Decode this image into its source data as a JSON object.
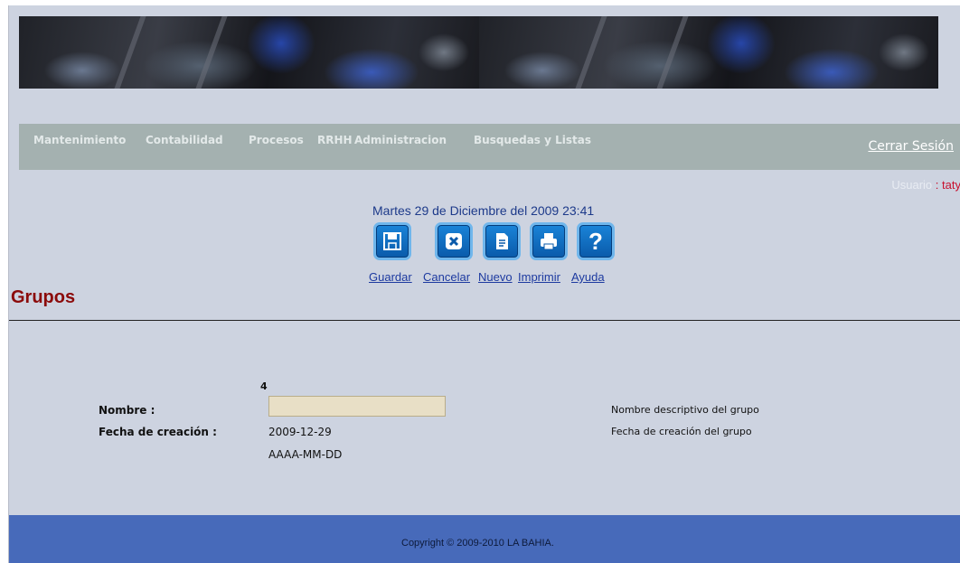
{
  "nav": {
    "items": [
      "Mantenimiento",
      "Contabilidad",
      "Procesos",
      "RRHH",
      "Administracion",
      "Busquedas y Listas"
    ],
    "logout": "Cerrar Sesión"
  },
  "user": {
    "label": "Usuario",
    "separator": ":",
    "name": "taty"
  },
  "date": "Martes 29 de Diciembre del 2009 23:41",
  "toolbar": {
    "guardar": "Guardar",
    "cancelar": "Cancelar",
    "nuevo": "Nuevo",
    "imprimir": "Imprimir",
    "ayuda": "Ayuda",
    "icons": [
      "save-icon",
      "cancel-icon",
      "new-document-icon",
      "print-icon",
      "help-icon"
    ]
  },
  "page_title": "Grupos",
  "form": {
    "id_value": "4",
    "nombre_label": "Nombre :",
    "nombre_value": "",
    "nombre_help": "Nombre descriptivo del grupo",
    "fecha_label": "Fecha de creación :",
    "fecha_value": "2009-12-29",
    "fecha_format": "AAAA-MM-DD",
    "fecha_help": "Fecha de creación del grupo"
  },
  "footer": {
    "copyright": "Copyright © 2009-2010 LA BAHIA."
  },
  "colors": {
    "nav_bg": "#a4b1b0",
    "page_bg": "#cdd3e0",
    "footer_bg": "#476aba",
    "title": "#8b0a0a",
    "button": "#0a6ac0"
  }
}
